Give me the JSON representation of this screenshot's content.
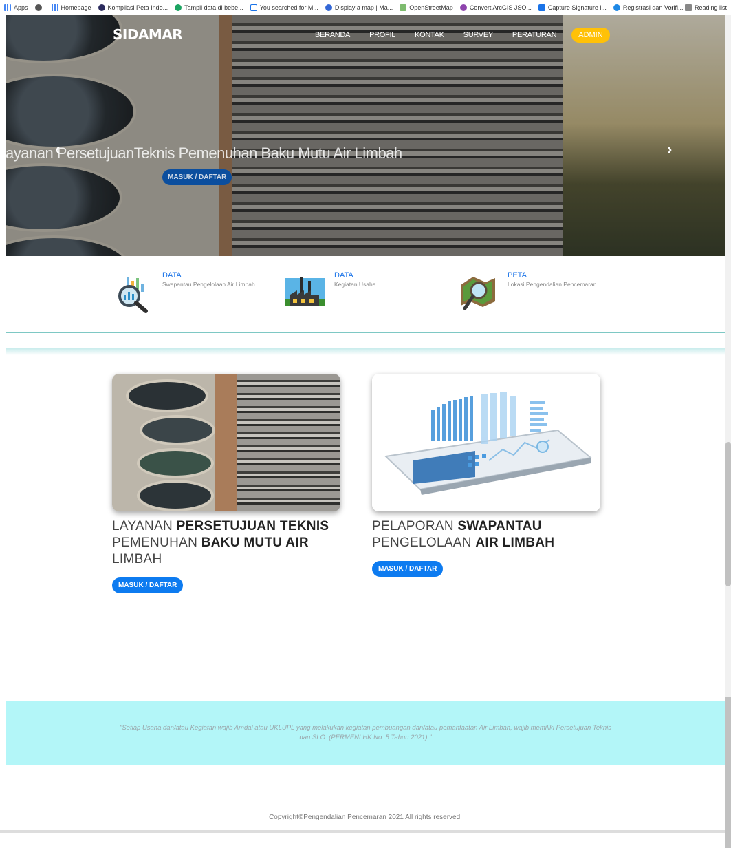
{
  "bookmarks": {
    "items": [
      {
        "label": "Apps",
        "icon": "apps-grid-icon"
      },
      {
        "label": "",
        "icon": "globe-icon"
      },
      {
        "label": "Homepage",
        "icon": "grid-icon"
      },
      {
        "label": "Kompilasi Peta Indo...",
        "icon": "map-icon"
      },
      {
        "label": "Tampil data di bebe...",
        "icon": "s-icon"
      },
      {
        "label": "You searched for M...",
        "icon": "code-icon"
      },
      {
        "label": "Display a map | Ma...",
        "icon": "map-pin-icon"
      },
      {
        "label": "OpenStreetMap",
        "icon": "osm-icon"
      },
      {
        "label": "Convert ArcGIS JSO...",
        "icon": "location-icon"
      },
      {
        "label": "Capture Signature i...",
        "icon": "m-icon"
      },
      {
        "label": "Registrasi dan Verifi...",
        "icon": "circle-icon"
      }
    ],
    "more": "»",
    "reading_list": "Reading list"
  },
  "header": {
    "logo": "SIDAMAR",
    "nav": [
      "BERANDA",
      "PROFIL",
      "KONTAK",
      "SURVEY",
      "PERATURAN"
    ],
    "admin": "ADMIN"
  },
  "hero": {
    "title": "ayanan PersetujuanTeknis Pemenuhan Baku Mutu Air Limbah",
    "button": "MASUK / DAFTAR",
    "prev": "‹",
    "next": "›"
  },
  "features": [
    {
      "title": "DATA",
      "desc": "Swapantau Pengelolaan Air Limbah",
      "icon": "magnifier-chart-icon"
    },
    {
      "title": "DATA",
      "desc": "Kegiatan Usaha",
      "icon": "factory-icon"
    },
    {
      "title": "PETA",
      "desc": "Lokasi Pengendalian Pencemaran",
      "icon": "map-magnifier-icon"
    }
  ],
  "cards": [
    {
      "title_light1": "LAYANAN ",
      "title_bold1": "PERSETUJUAN TEKNIS",
      "title_light2": " PEMENUHAN ",
      "title_bold2": "BAKU MUTU AIR",
      "title_light3": " LIMBAH",
      "button": "MASUK / DAFTAR"
    },
    {
      "title_light1": "PELAPORAN ",
      "title_bold1": "SWAPANTAU",
      "title_light2": " PENGELOLAAN ",
      "title_bold2": "AIR LIMBAH",
      "title_light3": "",
      "button": "MASUK / DAFTAR"
    }
  ],
  "quote": "\"Setiap Usaha dan/atau Kegiatan wajib Amdal atau UKLUPL yang melakukan kegiatan pembuangan dan/atau pemanfaatan Air Limbah, wajib memiliki Persetujuan Teknis dan SLO. (PERMENLHK No. 5 Tahun 2021) \"",
  "footer": "Copyright©Pengendalian Pencemaran 2021 All rights reserved.",
  "colors": {
    "accent": "#0d7bf0",
    "admin": "#ffc107",
    "quote_bg": "#b3f6f8",
    "divider": "#7ec8c4"
  }
}
